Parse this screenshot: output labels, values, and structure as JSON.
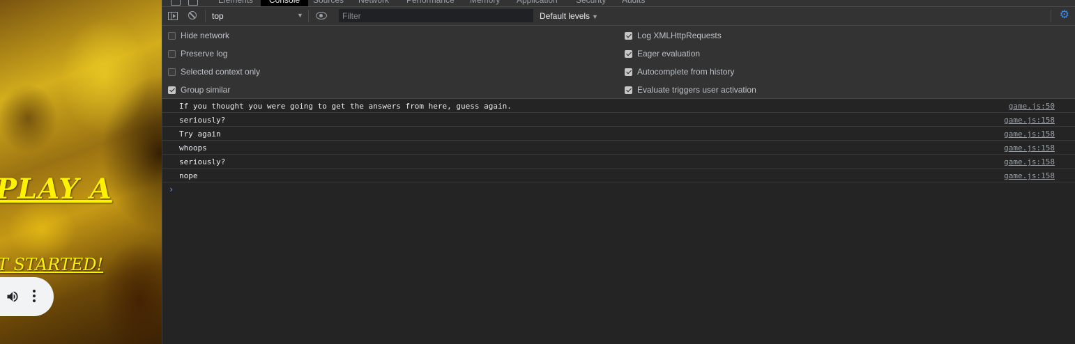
{
  "page": {
    "heading": "PLAY A",
    "link": "T STARTED!",
    "audio_volume_icon": "volume-icon",
    "audio_more_icon": "more-vert-icon"
  },
  "devtools": {
    "tabs": [
      "Elements",
      "Console",
      "Sources",
      "Network",
      "Performance",
      "Memory",
      "Application",
      "Security",
      "Audits"
    ],
    "active_tab": "Console",
    "toolbar": {
      "context": "top",
      "filter_placeholder": "Filter",
      "filter_value": "",
      "levels": "Default levels"
    },
    "settings": {
      "left": [
        {
          "label": "Hide network",
          "checked": false
        },
        {
          "label": "Preserve log",
          "checked": false
        },
        {
          "label": "Selected context only",
          "checked": false
        },
        {
          "label": "Group similar",
          "checked": true
        }
      ],
      "right": [
        {
          "label": "Log XMLHttpRequests",
          "checked": true
        },
        {
          "label": "Eager evaluation",
          "checked": true
        },
        {
          "label": "Autocomplete from history",
          "checked": true
        },
        {
          "label": "Evaluate triggers user activation",
          "checked": true
        }
      ]
    },
    "messages": [
      {
        "text": "If you thought you were going to get the answers from here, guess again.",
        "source": "game.js:50"
      },
      {
        "text": "seriously?",
        "source": "game.js:158"
      },
      {
        "text": "Try again",
        "source": "game.js:158"
      },
      {
        "text": "whoops",
        "source": "game.js:158"
      },
      {
        "text": "seriously?",
        "source": "game.js:158"
      },
      {
        "text": "nope",
        "source": "game.js:158"
      }
    ],
    "prompt_symbol": "›"
  },
  "colors": {
    "accent": "#3c8cf0",
    "page_text": "#fff200",
    "panel_bg": "#333333",
    "console_bg": "#242424"
  }
}
